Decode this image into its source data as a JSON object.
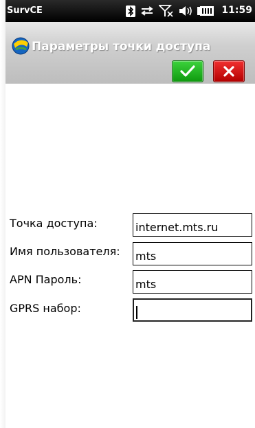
{
  "status_bar": {
    "app_name": "SurvCE",
    "time": "11:59",
    "icons": [
      "bluetooth-icon",
      "data-sync-icon",
      "signal-off-icon",
      "speaker-icon",
      "battery-icon"
    ]
  },
  "window": {
    "title": "Параметры точки доступа",
    "logo": "survce-logo-icon",
    "ok_icon": "checkmark-icon",
    "cancel_icon": "close-icon"
  },
  "form": {
    "access_point": {
      "label": "Точка доступа:",
      "value": "internet.mts.ru"
    },
    "username": {
      "label": "Имя пользователя:",
      "value": "mts"
    },
    "apn_password": {
      "label": "APN Пароль:",
      "value": "mts"
    },
    "gprs_dial": {
      "label": "GPRS набор:",
      "value": ""
    }
  },
  "colors": {
    "ok_button": "#1fb41f",
    "cancel_button": "#d40000",
    "status_bar": "#000000"
  }
}
